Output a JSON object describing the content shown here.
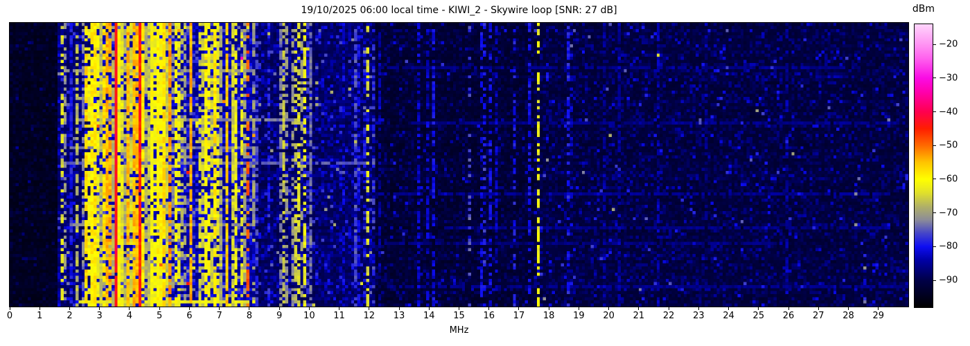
{
  "chart_data": {
    "type": "heatmap",
    "title": "19/10/2025 06:00 local time - KIWI_2 - Skywire loop [SNR: 27 dB]",
    "xlabel": "MHz",
    "x_range_mhz": [
      0,
      30
    ],
    "x_ticks": [
      0,
      1,
      2,
      3,
      4,
      5,
      6,
      7,
      8,
      9,
      10,
      11,
      12,
      13,
      14,
      15,
      16,
      17,
      18,
      19,
      20,
      21,
      22,
      23,
      24,
      25,
      26,
      27,
      28,
      29
    ],
    "grid_visible": false,
    "colorbar": {
      "label": "dBm",
      "ticks": [
        -20,
        -30,
        -40,
        -50,
        -60,
        -70,
        -80,
        -90
      ],
      "range_dbm": [
        -98,
        -14
      ],
      "colormap_stops": [
        [
          0.0,
          "#000000"
        ],
        [
          0.095,
          "#000047"
        ],
        [
          0.167,
          "#0000a6"
        ],
        [
          0.214,
          "#0d0df2"
        ],
        [
          0.262,
          "#4646c8"
        ],
        [
          0.31,
          "#8d8d97"
        ],
        [
          0.357,
          "#b1b166"
        ],
        [
          0.405,
          "#e1e12a"
        ],
        [
          0.452,
          "#ffff00"
        ],
        [
          0.512,
          "#ffc400"
        ],
        [
          0.571,
          "#ff6a00"
        ],
        [
          0.631,
          "#ff1e00"
        ],
        [
          0.69,
          "#ff004e"
        ],
        [
          0.762,
          "#ff00ae"
        ],
        [
          0.81,
          "#fa0ce4"
        ],
        [
          0.881,
          "#ff63ee"
        ],
        [
          0.929,
          "#ff94f3"
        ],
        [
          1.0,
          "#ffd5fc"
        ]
      ]
    },
    "spectrum": {
      "description": "24h HF waterfall, 0-30 MHz; strong broadcast/utility activity 1.6-8 MHz, moderate 9-12 MHz, quiet above 12 MHz with sparse carriers and lightning-static rows",
      "grid": [
        300,
        92
      ],
      "seed": 1337,
      "floor_regions": [
        {
          "to_mhz": 1.55,
          "level": -95.2,
          "spread": 1.6
        },
        {
          "to_mhz": 2.62,
          "level": -89.5,
          "spread": 3.6
        },
        {
          "to_mhz": 5.35,
          "level": -86.0,
          "spread": 5.0
        },
        {
          "to_mhz": 8.15,
          "level": -86.5,
          "spread": 5.0
        },
        {
          "to_mhz": 12.2,
          "level": -90.0,
          "spread": 3.4
        },
        {
          "to_mhz": 17.55,
          "level": -93.5,
          "spread": 2.3
        },
        {
          "to_mhz": 30.0,
          "level": -92.5,
          "spread": 2.7
        }
      ],
      "bands": [
        {
          "f0": 1.58,
          "f1": 2.62,
          "density": 0.6,
          "lmin": -80,
          "lmax": -62,
          "dash": 0.4
        },
        {
          "f0": 2.62,
          "f1": 5.35,
          "density": 0.95,
          "lmin": -69,
          "lmax": -52,
          "dash": 0.2
        },
        {
          "f0": 5.35,
          "f1": 6.3,
          "density": 0.65,
          "lmin": -77,
          "lmax": -58,
          "dash": 0.4
        },
        {
          "f0": 6.3,
          "f1": 7.65,
          "density": 0.85,
          "lmin": -71,
          "lmax": -55,
          "dash": 0.28
        },
        {
          "f0": 7.65,
          "f1": 8.15,
          "density": 0.6,
          "lmin": -74,
          "lmax": -60,
          "dash": 0.42
        },
        {
          "f0": 8.15,
          "f1": 8.95,
          "density": 0.3,
          "lmin": -83,
          "lmax": -73,
          "dash": 0.5
        },
        {
          "f0": 8.95,
          "f1": 10.1,
          "density": 0.6,
          "lmin": -81,
          "lmax": -64,
          "dash": 0.45
        },
        {
          "f0": 10.1,
          "f1": 11.45,
          "density": 0.25,
          "lmin": -83,
          "lmax": -73,
          "dash": 0.5
        },
        {
          "f0": 11.45,
          "f1": 12.2,
          "density": 0.55,
          "lmin": -81,
          "lmax": -66,
          "dash": 0.48
        },
        {
          "f0": 12.2,
          "f1": 17.5,
          "density": 0.1,
          "lmin": -86,
          "lmax": -77,
          "dash": 0.55
        },
        {
          "f0": 17.7,
          "f1": 29.9,
          "density": 0.05,
          "lmin": -87,
          "lmax": -79,
          "dash": 0.55
        }
      ],
      "carrier_lines": [
        {
          "f": 1.71,
          "level": -64,
          "dash": 0.5
        },
        {
          "f": 2.46,
          "level": -57,
          "dash": 0.25
        },
        {
          "f": 2.81,
          "level": -58,
          "dash": 0.1
        },
        {
          "f": 3.5,
          "level": -43,
          "dash": 0.02
        },
        {
          "f": 4.27,
          "level": -45,
          "dash": 0.02
        },
        {
          "f": 5.0,
          "level": -60,
          "dash": 0.12
        },
        {
          "f": 5.97,
          "level": -54,
          "dash": 0.12
        },
        {
          "f": 6.79,
          "level": -58,
          "dash": 0.2
        },
        {
          "f": 7.21,
          "level": -56,
          "dash": 0.18
        },
        {
          "f": 7.89,
          "level": -49,
          "dash": 0.6
        },
        {
          "f": 9.47,
          "level": -66,
          "dash": 0.5
        },
        {
          "f": 9.77,
          "level": -63,
          "dash": 0.42
        },
        {
          "f": 11.9,
          "level": -64,
          "dash": 0.55
        },
        {
          "f": 13.55,
          "level": -82,
          "dash": 0.45
        },
        {
          "f": 14.05,
          "level": -81,
          "dash": 0.4
        },
        {
          "f": 15.3,
          "level": -76,
          "dash": 0.75
        },
        {
          "f": 16.15,
          "level": -83,
          "dash": 0.5
        },
        {
          "f": 17.62,
          "level": -62,
          "dash": 0.4
        },
        {
          "f": 21.55,
          "level": -84,
          "dash": 0.5
        },
        {
          "f": 25.9,
          "level": -85,
          "dash": 0.5
        }
      ],
      "horizontal_streaks": [
        {
          "row": 0.151,
          "f0": 12.3,
          "f1": 28.3,
          "level": -86.0
        },
        {
          "row": 0.163,
          "f0": 1.8,
          "f1": 8.1,
          "level": -72.0
        },
        {
          "row": 0.345,
          "f0": 2.2,
          "f1": 9.4,
          "level": -73.0
        },
        {
          "row": 0.355,
          "f0": 13.4,
          "f1": 29.8,
          "level": -86.0
        },
        {
          "row": 0.44,
          "f0": 2.0,
          "f1": 8.0,
          "level": -73.0
        },
        {
          "row": 0.49,
          "f0": 1.9,
          "f1": 12.1,
          "level": -75.0
        },
        {
          "row": 0.6,
          "f0": 12.3,
          "f1": 29.5,
          "level": -85.5
        },
        {
          "row": 0.71,
          "f0": 2.0,
          "f1": 8.0,
          "level": -72.5
        },
        {
          "row": 0.725,
          "f0": 14.5,
          "f1": 29.2,
          "level": -86.0
        },
        {
          "row": 0.775,
          "f0": 12.5,
          "f1": 25.5,
          "level": -86.5
        },
        {
          "row": 0.93,
          "f0": 12.5,
          "f1": 29.7,
          "level": -86.0
        },
        {
          "row": 0.985,
          "f0": 2.3,
          "f1": 8.1,
          "level": -63.0
        }
      ]
    }
  }
}
